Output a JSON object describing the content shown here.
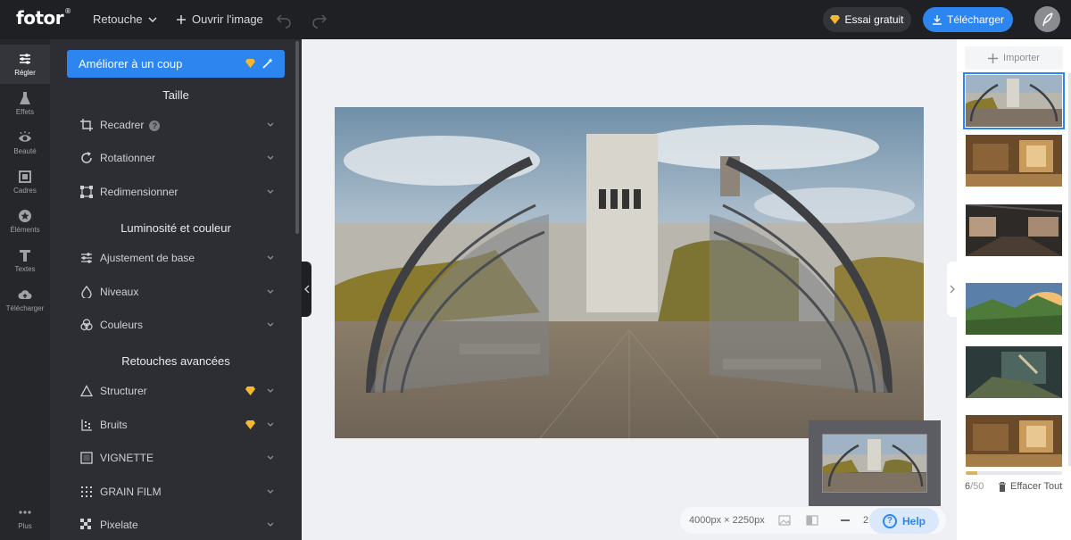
{
  "topbar": {
    "logo": "fotor",
    "logo_mark": "®",
    "mode_label": "Retouche",
    "open_image_label": "Ouvrir l'image",
    "trial_label": "Essai gratuit",
    "download_label": "Télécharger"
  },
  "rail": {
    "items": [
      {
        "label": "Régler",
        "icon": "sliders-icon"
      },
      {
        "label": "Effets",
        "icon": "flask-icon"
      },
      {
        "label": "Beauté",
        "icon": "eye-icon"
      },
      {
        "label": "Cadres",
        "icon": "frame-icon"
      },
      {
        "label": "Éléments",
        "icon": "star-icon"
      },
      {
        "label": "Textes",
        "icon": "text-icon"
      },
      {
        "label": "Télécharger",
        "icon": "cloud-upload-icon"
      },
      {
        "label": "Plus",
        "icon": "more-icon"
      }
    ]
  },
  "panel": {
    "ameliorer_label": "Améliorer à un coup",
    "sections": {
      "taille": "Taille",
      "luminosite": "Luminosité et couleur",
      "retouches": "Retouches avancées"
    },
    "tools": {
      "recadrer": "Recadrer",
      "rotationner": "Rotationner",
      "redimensionner": "Redimensionner",
      "ajustement": "Ajustement de base",
      "niveaux": "Niveaux",
      "couleurs": "Couleurs",
      "structurer": "Structurer",
      "bruits": "Bruits",
      "vignette": "VIGNETTE",
      "grain": "GRAIN FILM",
      "pixelate": "Pixelate"
    },
    "help_glyph": "?"
  },
  "canvas": {
    "dimensions": "4000px × 2250px",
    "zoom_partial": "2",
    "help_label": "Help",
    "help_glyph": "?"
  },
  "gallery": {
    "importer_label": "Importer",
    "count_current": "6",
    "count_total": "/50",
    "progress_fraction": 0.12,
    "clear_label": "Effacer Tout"
  },
  "colors": {
    "accent": "#2d86f0",
    "premium": "#f5b82e",
    "topbar": "#1f2024",
    "panel": "#2d2e33"
  }
}
